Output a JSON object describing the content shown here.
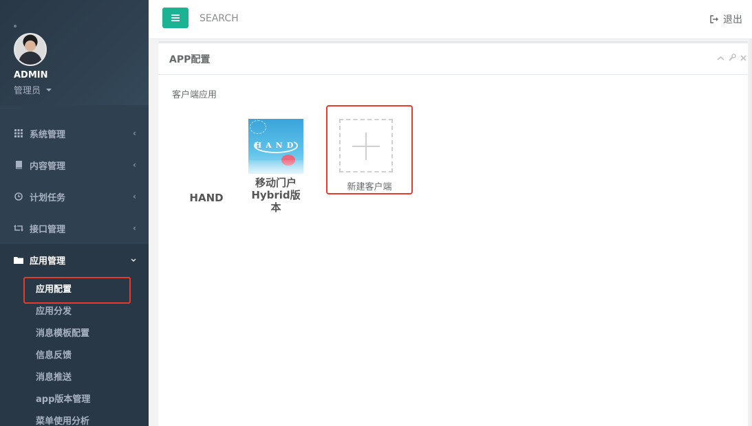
{
  "sidebar": {
    "profile": {
      "name": "ADMIN",
      "role": "管理员"
    },
    "menu": [
      {
        "label": "系统管理",
        "icon": "grid-icon",
        "expanded": false
      },
      {
        "label": "内容管理",
        "icon": "book-icon",
        "expanded": false
      },
      {
        "label": "计划任务",
        "icon": "clock-icon",
        "expanded": false
      },
      {
        "label": "接口管理",
        "icon": "retweet-icon",
        "expanded": false
      },
      {
        "label": "应用管理",
        "icon": "folder-icon",
        "expanded": true
      }
    ],
    "submenu": [
      {
        "label": "应用配置",
        "current": true
      },
      {
        "label": "应用分发"
      },
      {
        "label": "消息模板配置"
      },
      {
        "label": "信息反馈"
      },
      {
        "label": "消息推送"
      },
      {
        "label": "app版本管理"
      },
      {
        "label": "菜单使用分析"
      }
    ]
  },
  "topbar": {
    "search_placeholder": "SEARCH",
    "logout_label": "退出"
  },
  "panel": {
    "title": "APP配置",
    "section_label": "客户端应用",
    "apps": [
      {
        "name": "HAND"
      },
      {
        "name_line1": "移动门户",
        "name_line2": "Hybrid版本",
        "logo_text": "HAND"
      }
    ],
    "new_client_label": "新建客户端"
  },
  "colors": {
    "sidebar_bg": "#2f4050",
    "accent": "#1ab394",
    "highlight_border": "#e63a2a"
  }
}
